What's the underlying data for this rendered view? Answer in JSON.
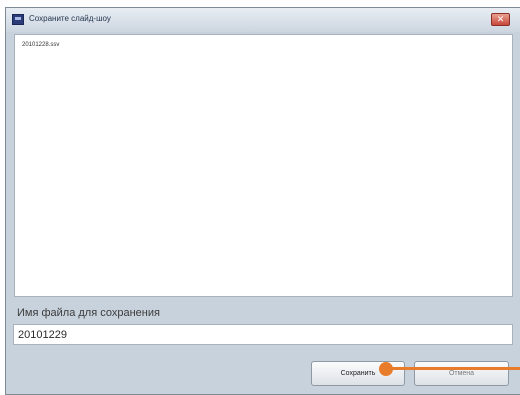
{
  "window": {
    "title": "Сохраните слайд-шоу",
    "close_symbol": "✕"
  },
  "file_list": {
    "items": [
      "20101228.ssv"
    ]
  },
  "filename": {
    "label": "Имя файла для сохранения",
    "value": "20101229"
  },
  "buttons": {
    "save_label": "Сохранить",
    "cancel_label": "Отмена"
  },
  "colors": {
    "pointer_accent": "#e87c2a",
    "dialog_background": "#c8d2dc"
  },
  "icons": {
    "app": "slideshow-app-icon",
    "close": "close-icon"
  }
}
